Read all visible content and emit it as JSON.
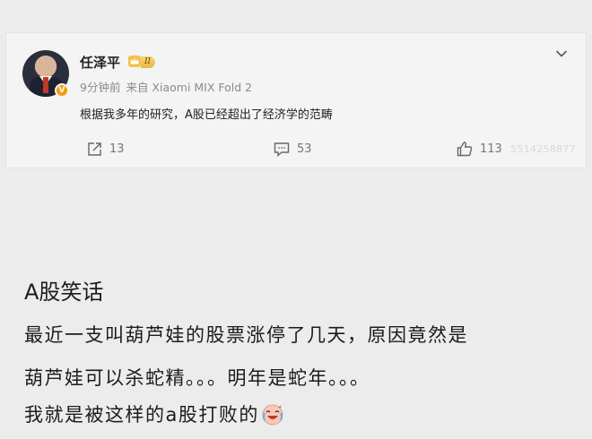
{
  "post": {
    "username": "任泽平",
    "level": "II",
    "time": "9分钟前",
    "source": "来自 Xiaomi MIX Fold 2",
    "text": "根据我多年的研究，A股已经超出了经济学的范畴",
    "reposts": "13",
    "comments": "53",
    "likes": "113",
    "watermark": "5514258877"
  },
  "article": {
    "heading": "A股笑话",
    "lines": [
      "最近一支叫葫芦娃的股票涨停了几天，原因竟然是",
      "葫芦娃可以杀蛇精。。。明年是蛇年。。。",
      "我就是被这样的a股打败的"
    ]
  },
  "icons": {
    "verified": "verified-badge-icon",
    "crown": "crown-icon",
    "menu": "chevron-down-icon",
    "repost": "repost-icon",
    "comment": "comment-icon",
    "like": "thumbs-up-icon",
    "emoji": "laugh-cry-emoji-icon"
  },
  "colors": {
    "verified_badge": "#f29b12",
    "level_badge": "#e9b94a",
    "text": "#1c1c1c",
    "muted": "#8a8a8a"
  }
}
